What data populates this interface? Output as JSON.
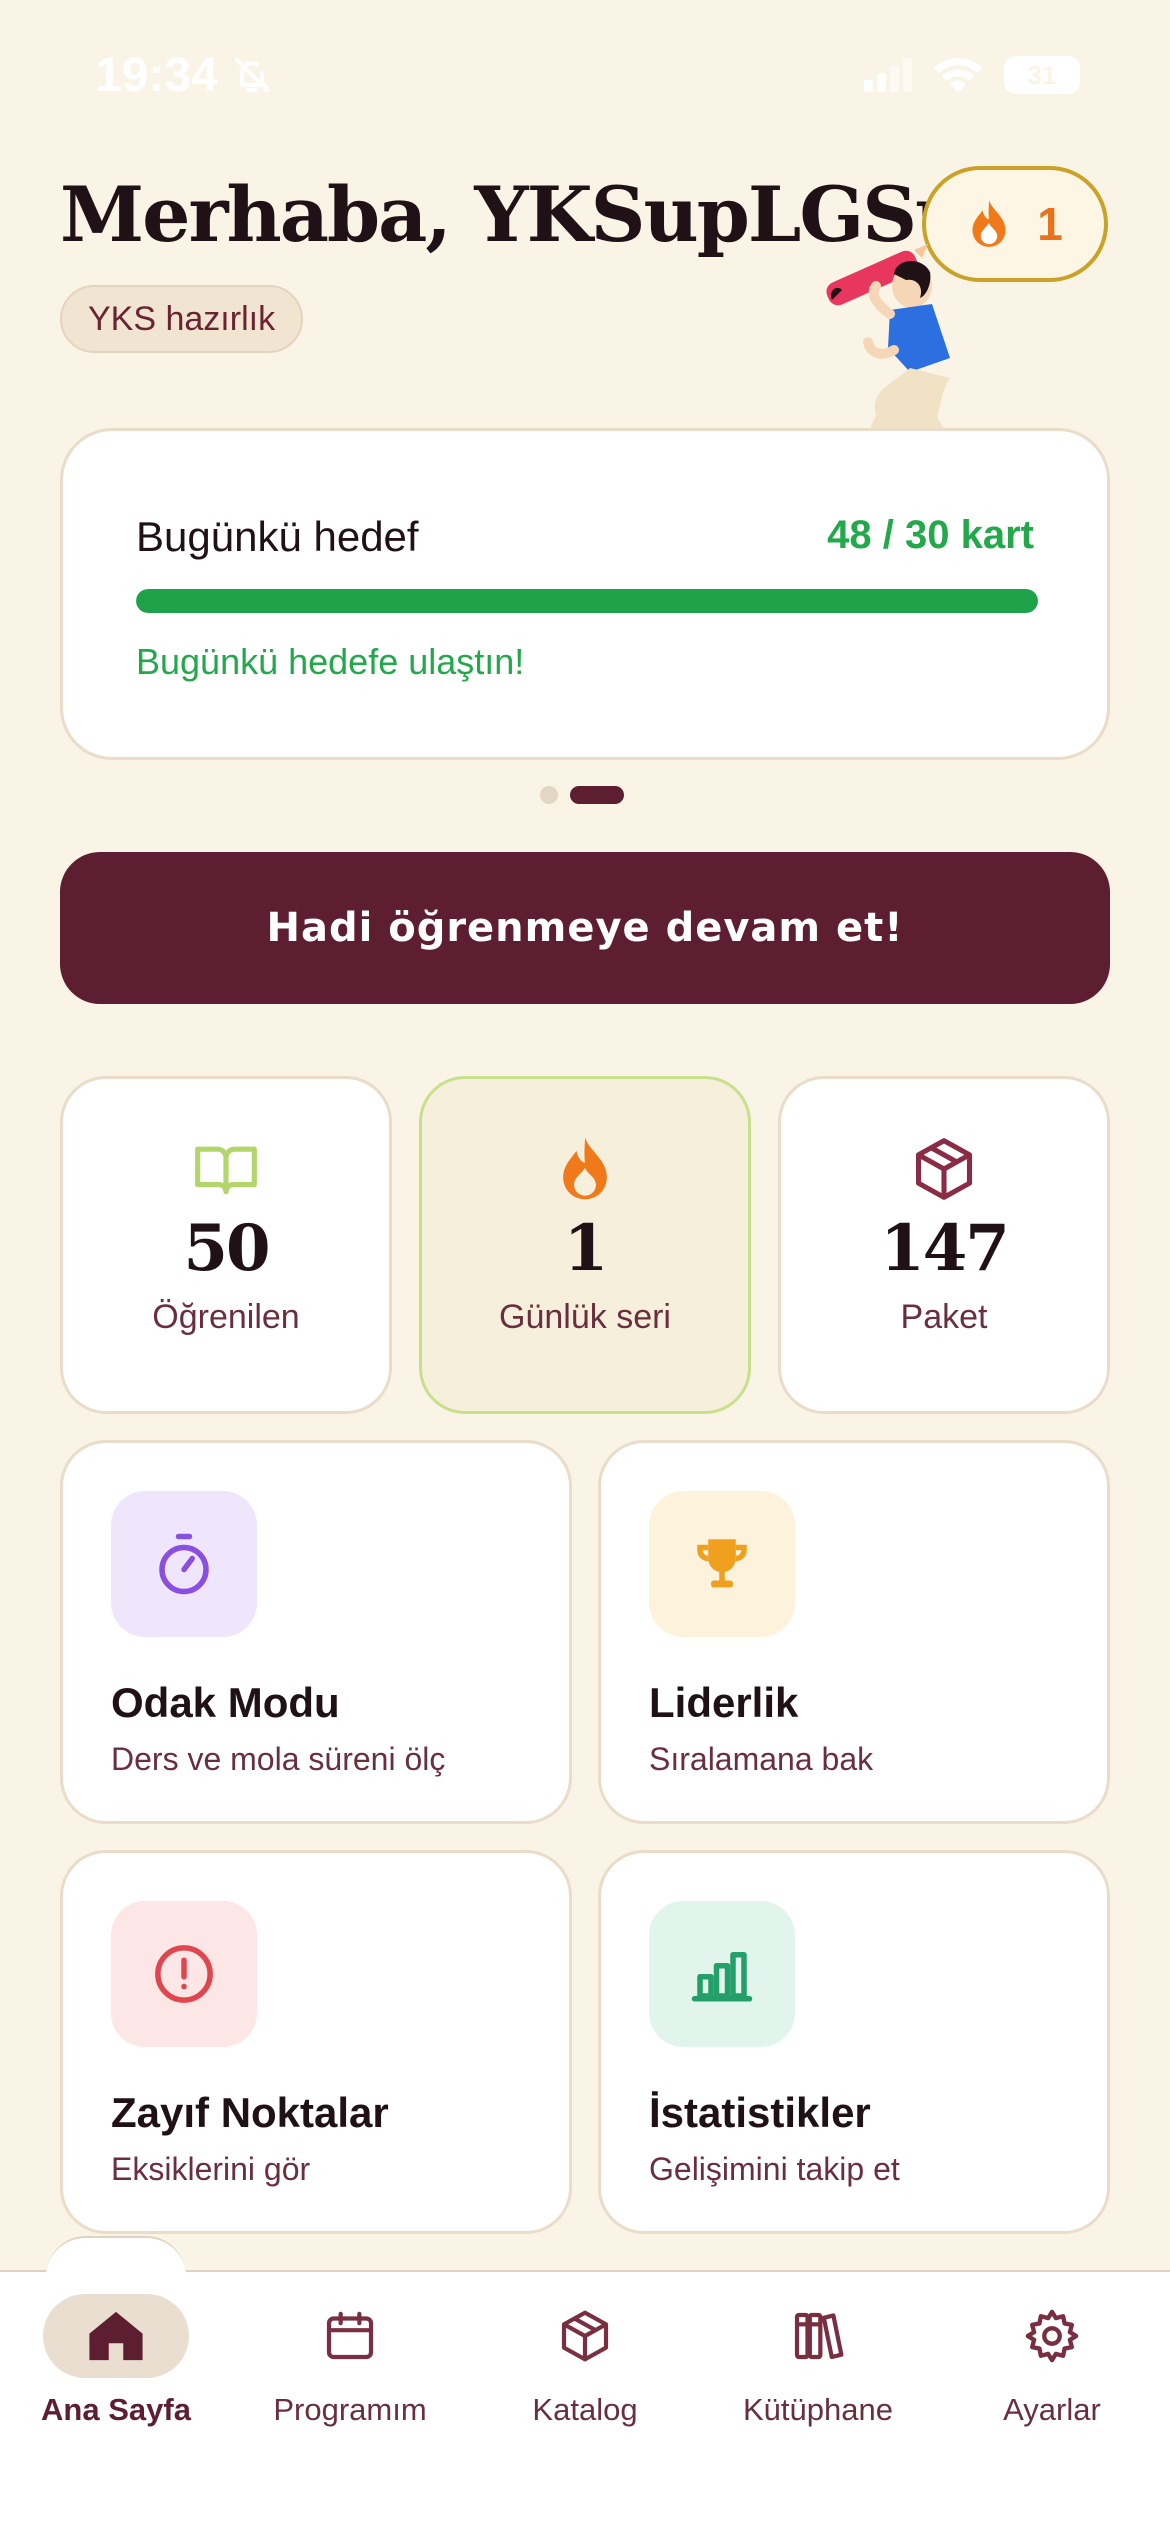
{
  "status_bar": {
    "time": "19:34",
    "battery": "31"
  },
  "header": {
    "greeting": "Merhaba, YKSupLGSup",
    "profile_tag": "YKS hazırlık",
    "streak_count": "1"
  },
  "goal": {
    "label": "Bugünkü hedef",
    "value": "48 / 30 kart",
    "progress": 1.0,
    "message": "Bugünkü hedefe ulaştın!"
  },
  "pager": {
    "pages": 2,
    "active": 2
  },
  "cta": {
    "label": "Hadi öğrenmeye devam et!"
  },
  "stats": [
    {
      "value": "50",
      "label": "Öğrenilen",
      "icon": "book-icon"
    },
    {
      "value": "1",
      "label": "Günlük seri",
      "icon": "flame-icon"
    },
    {
      "value": "147",
      "label": "Paket",
      "icon": "package-icon"
    }
  ],
  "features": [
    {
      "title": "Odak Modu",
      "subtitle": "Ders ve mola süreni ölç",
      "icon": "timer-icon",
      "color": "#8a4ee0"
    },
    {
      "title": "Liderlik",
      "subtitle": "Sıralamana bak",
      "icon": "trophy-icon",
      "color": "#f0a01e"
    },
    {
      "title": "Zayıf Noktalar",
      "subtitle": "Eksiklerini gör",
      "icon": "alert-icon",
      "color": "#e0464e"
    },
    {
      "title": "İstatistikler",
      "subtitle": "Gelişimini takip et",
      "icon": "bar-chart-icon",
      "color": "#23a06a"
    }
  ],
  "nav": [
    {
      "label": "Ana Sayfa",
      "icon": "home-icon",
      "active": true
    },
    {
      "label": "Programım",
      "icon": "calendar-icon",
      "active": false
    },
    {
      "label": "Katalog",
      "icon": "package-icon",
      "active": false
    },
    {
      "label": "Kütüphane",
      "icon": "books-icon",
      "active": false
    },
    {
      "label": "Ayarlar",
      "icon": "gear-icon",
      "active": false
    }
  ],
  "colors": {
    "background": "#faf4e6",
    "primary": "#5c1e30",
    "success": "#1fa34a",
    "streak": "#e8731e"
  }
}
